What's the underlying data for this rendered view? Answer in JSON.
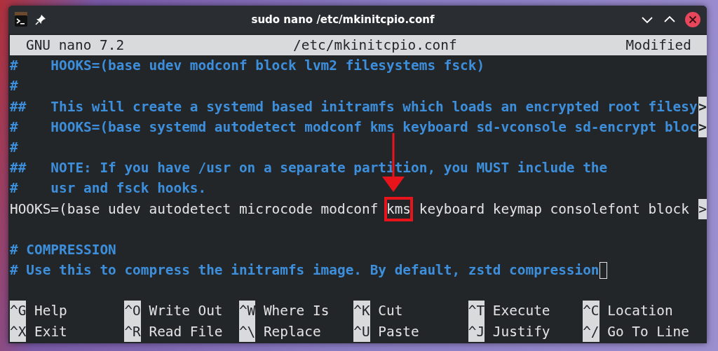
{
  "window": {
    "title": "sudo nano /etc/mkinitcpio.conf"
  },
  "nano_header": {
    "version": "GNU nano 7.2",
    "filename": "/etc/mkinitcpio.conf",
    "status": "Modified"
  },
  "lines": [
    {
      "kind": "comment",
      "segments": [
        {
          "text": "#    HOOKS=(base udev modconf block lvm2 filesystems fsck)",
          "highlighted": false
        }
      ]
    },
    {
      "kind": "comment",
      "segments": [
        {
          "text": "#",
          "highlighted": false
        }
      ]
    },
    {
      "kind": "comment",
      "segments": [
        {
          "text": "##   This will create a systemd based initramfs which loads an encrypted root filesy",
          "highlighted": false
        }
      ],
      "overflow_marker": ">"
    },
    {
      "kind": "comment",
      "segments": [
        {
          "text": "#    HOOKS=(base systemd autodetect modconf kms keyboard sd-vconsole sd-encrypt bloc",
          "highlighted": false
        }
      ],
      "overflow_marker": ">"
    },
    {
      "kind": "comment",
      "segments": [
        {
          "text": "#",
          "highlighted": false
        }
      ]
    },
    {
      "kind": "comment",
      "segments": [
        {
          "text": "##   NOTE: If you have /usr on a separate partition, you MUST include the",
          "highlighted": false
        }
      ]
    },
    {
      "kind": "comment",
      "segments": [
        {
          "text": "#    usr and fsck hooks.",
          "highlighted": false
        }
      ]
    },
    {
      "kind": "code",
      "segments": [
        {
          "text": "HOOKS=(base udev autodetect microcode modconf ",
          "highlighted": false
        },
        {
          "text": "kms",
          "highlighted": true
        },
        {
          "text": " keyboard keymap consolefont block ",
          "highlighted": false
        }
      ],
      "overflow_marker": ">"
    },
    {
      "kind": "blank"
    },
    {
      "kind": "comment",
      "segments": [
        {
          "text": "# COMPRESSION",
          "highlighted": false
        }
      ]
    },
    {
      "kind": "comment",
      "segments": [
        {
          "text": "# Use this to compress the initramfs image. By default, zstd compression",
          "highlighted": false
        }
      ],
      "cursor": true
    },
    {
      "kind": "blank"
    }
  ],
  "shortcuts": [
    {
      "key": "^G",
      "label": "Help"
    },
    {
      "key": "^O",
      "label": "Write Out"
    },
    {
      "key": "^W",
      "label": "Where Is"
    },
    {
      "key": "^K",
      "label": "Cut"
    },
    {
      "key": "^T",
      "label": "Execute"
    },
    {
      "key": "^C",
      "label": "Location"
    },
    {
      "key": "^X",
      "label": "Exit"
    },
    {
      "key": "^R",
      "label": "Read File"
    },
    {
      "key": "^\\",
      "label": "Replace"
    },
    {
      "key": "^U",
      "label": "Paste"
    },
    {
      "key": "^J",
      "label": "Justify"
    },
    {
      "key": "^/",
      "label": "Go To Line"
    }
  ]
}
